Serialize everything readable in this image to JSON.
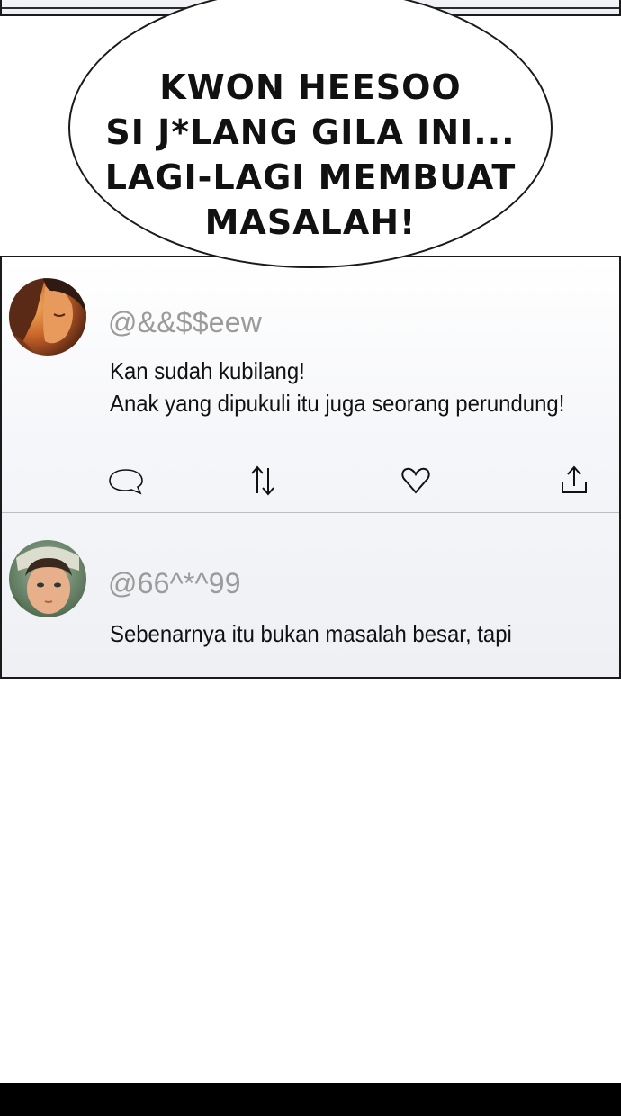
{
  "speech_bubble": {
    "lines": [
      "KWON HEESOO",
      "SI J*LANG GILA INI...",
      "LAGI-LAGI MEMBUAT",
      "MASALAH!"
    ]
  },
  "posts": [
    {
      "handle": "@&&$$eew",
      "lines": [
        "Kan sudah kubilang!",
        "Anak yang dipukuli itu juga seorang perundung!"
      ],
      "actions": [
        "comment-icon",
        "repost-icon",
        "like-icon",
        "share-icon"
      ]
    },
    {
      "handle": "@66^*^99",
      "lines": [
        "Sebenarnya itu bukan masalah besar, tapi"
      ]
    }
  ]
}
